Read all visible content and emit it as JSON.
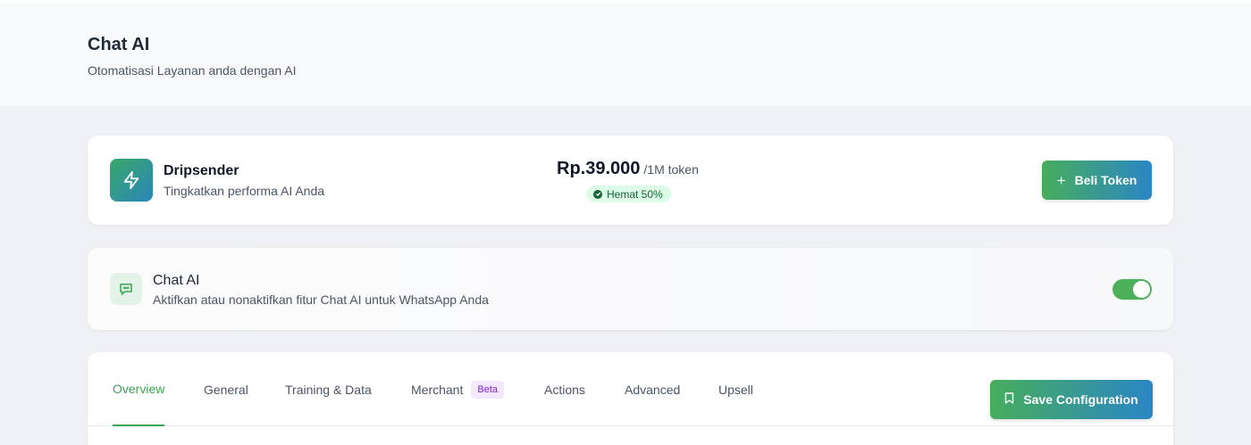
{
  "header": {
    "title": "Chat AI",
    "subtitle": "Otomatisasi Layanan anda dengan AI"
  },
  "promo": {
    "icon": "lightning-icon",
    "name": "Dripsender",
    "description": "Tingkatkan performa AI Anda",
    "price": "Rp.39.000",
    "price_unit": "/1M token",
    "badge": "Hemat 50%",
    "button_label": "Beli Token"
  },
  "chat_ai": {
    "icon": "chat-bubble-icon",
    "title": "Chat AI",
    "description": "Aktifkan atau nonaktifkan fitur Chat AI untuk WhatsApp Anda",
    "enabled": true
  },
  "tabs": [
    {
      "label": "Overview",
      "active": true
    },
    {
      "label": "General",
      "active": false
    },
    {
      "label": "Training & Data",
      "active": false
    },
    {
      "label": "Merchant",
      "active": false,
      "badge": "Beta"
    },
    {
      "label": "Actions",
      "active": false
    },
    {
      "label": "Advanced",
      "active": false
    },
    {
      "label": "Upsell",
      "active": false
    }
  ],
  "save_button_label": "Save Configuration",
  "colors": {
    "accent_green": "#3aa552",
    "accent_blue": "#2b86c5",
    "badge_green_bg": "#dcfce7",
    "beta_purple": "#7e22ce"
  }
}
